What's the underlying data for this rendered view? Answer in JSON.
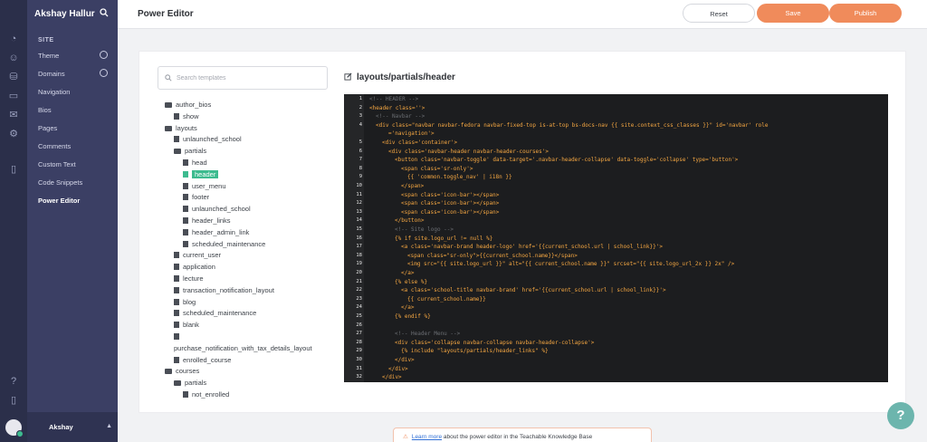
{
  "sidebar": {
    "user_name": "Akshay Hallur",
    "section": "SITE",
    "items": [
      {
        "label": "Theme",
        "status": true
      },
      {
        "label": "Domains",
        "status": true
      },
      {
        "label": "Navigation"
      },
      {
        "label": "Bios"
      },
      {
        "label": "Pages"
      },
      {
        "label": "Comments"
      },
      {
        "label": "Custom Text"
      },
      {
        "label": "Code Snippets"
      },
      {
        "label": "Power Editor",
        "active": true
      }
    ],
    "footer_name": "Akshay"
  },
  "header": {
    "title": "Power Editor",
    "reset_label": "Reset",
    "save_label": "Save",
    "publish_label": "Publish"
  },
  "search": {
    "placeholder": "Search templates"
  },
  "tree": [
    {
      "label": "author_bios",
      "kind": "folder",
      "depth": 0
    },
    {
      "label": "show",
      "kind": "file",
      "depth": 1
    },
    {
      "label": "layouts",
      "kind": "folder",
      "depth": 0
    },
    {
      "label": "unlaunched_school",
      "kind": "file",
      "depth": 1
    },
    {
      "label": "partials",
      "kind": "folder",
      "depth": 1
    },
    {
      "label": "head",
      "kind": "file",
      "depth": 2
    },
    {
      "label": "header",
      "kind": "file",
      "depth": 2,
      "selected": true
    },
    {
      "label": "user_menu",
      "kind": "file",
      "depth": 2
    },
    {
      "label": "footer",
      "kind": "file",
      "depth": 2
    },
    {
      "label": "unlaunched_school",
      "kind": "file",
      "depth": 2
    },
    {
      "label": "header_links",
      "kind": "file",
      "depth": 2
    },
    {
      "label": "header_admin_link",
      "kind": "file",
      "depth": 2
    },
    {
      "label": "scheduled_maintenance",
      "kind": "file",
      "depth": 2
    },
    {
      "label": "current_user",
      "kind": "file",
      "depth": 1
    },
    {
      "label": "application",
      "kind": "file",
      "depth": 1
    },
    {
      "label": "lecture",
      "kind": "file",
      "depth": 1
    },
    {
      "label": "transaction_notification_layout",
      "kind": "file",
      "depth": 1
    },
    {
      "label": "blog",
      "kind": "file",
      "depth": 1
    },
    {
      "label": "scheduled_maintenance",
      "kind": "file",
      "depth": 1
    },
    {
      "label": "blank",
      "kind": "file",
      "depth": 1
    },
    {
      "label": "",
      "kind": "file",
      "depth": 1
    },
    {
      "label": "purchase_notification_with_tax_details_layout",
      "kind": "text",
      "depth": 1
    },
    {
      "label": "enrolled_course",
      "kind": "file",
      "depth": 1
    },
    {
      "label": "courses",
      "kind": "folder",
      "depth": 0
    },
    {
      "label": "partials",
      "kind": "folder",
      "depth": 1
    },
    {
      "label": "not_enrolled",
      "kind": "file",
      "depth": 2
    }
  ],
  "editor": {
    "file_path": "layouts/partials/header",
    "lines": [
      {
        "n": 1,
        "text": "<!-- HEADER -->",
        "kind": "cm",
        "indent": 0
      },
      {
        "n": 2,
        "text": "<header class=''>",
        "kind": "tg",
        "indent": 0
      },
      {
        "n": 3,
        "text": "<!-- Navbar -->",
        "kind": "cm",
        "indent": 1
      },
      {
        "n": 4,
        "text": "<div class=\"navbar navbar-fedora navbar-fixed-top is-at-top bs-docs-nav {{ site.context_css_classes }}\" id='navbar' role",
        "kind": "tg",
        "indent": 1
      },
      {
        "n": null,
        "text": "='navigation'>",
        "kind": "tg",
        "indent": 3
      },
      {
        "n": 5,
        "text": "<div class='container'>",
        "kind": "tg",
        "indent": 2
      },
      {
        "n": 6,
        "text": "<div class='navbar-header navbar-header-courses'>",
        "kind": "tg",
        "indent": 3
      },
      {
        "n": 7,
        "text": "<button class='navbar-toggle' data-target='.navbar-header-collapse' data-toggle='collapse' type='button'>",
        "kind": "tg",
        "indent": 4
      },
      {
        "n": 8,
        "text": "<span class='sr-only'>",
        "kind": "tg",
        "indent": 5
      },
      {
        "n": 9,
        "text": "{{ 'common.toggle_nav' | i18n }}",
        "kind": "tg",
        "indent": 6
      },
      {
        "n": 10,
        "text": "</span>",
        "kind": "tg",
        "indent": 5
      },
      {
        "n": 11,
        "text": "<span class='icon-bar'></span>",
        "kind": "tg",
        "indent": 5
      },
      {
        "n": 12,
        "text": "<span class='icon-bar'></span>",
        "kind": "tg",
        "indent": 5
      },
      {
        "n": 13,
        "text": "<span class='icon-bar'></span>",
        "kind": "tg",
        "indent": 5
      },
      {
        "n": 14,
        "text": "</button>",
        "kind": "tg",
        "indent": 4
      },
      {
        "n": 15,
        "text": "<!-- Site logo -->",
        "kind": "cm",
        "indent": 4
      },
      {
        "n": 16,
        "text": "{% if site.logo_url != null %}",
        "kind": "tg",
        "indent": 4
      },
      {
        "n": 17,
        "text": "<a class='navbar-brand header-logo' href='{{current_school.url | school_link}}'>",
        "kind": "tg",
        "indent": 5
      },
      {
        "n": 18,
        "text": "<span class=\"sr-only\">{{current_school.name}}</span>",
        "kind": "tg",
        "indent": 6
      },
      {
        "n": 19,
        "text": "<img src=\"{{ site.logo_url }}\" alt=\"{{ current_school.name }}\" srcset=\"{{ site.logo_url_2x }} 2x\" />",
        "kind": "tg",
        "indent": 6
      },
      {
        "n": 20,
        "text": "</a>",
        "kind": "tg",
        "indent": 5
      },
      {
        "n": 21,
        "text": "{% else %}",
        "kind": "tg",
        "indent": 4
      },
      {
        "n": 22,
        "text": "<a class='school-title navbar-brand' href='{{current_school.url | school_link}}'>",
        "kind": "tg",
        "indent": 5
      },
      {
        "n": 23,
        "text": "{{ current_school.name}}",
        "kind": "tg",
        "indent": 6
      },
      {
        "n": 24,
        "text": "</a>",
        "kind": "tg",
        "indent": 5
      },
      {
        "n": 25,
        "text": "{% endif %}",
        "kind": "tg",
        "indent": 4
      },
      {
        "n": 26,
        "text": "",
        "kind": "tg",
        "indent": 0
      },
      {
        "n": 27,
        "text": "<!-- Header Menu -->",
        "kind": "cm",
        "indent": 4
      },
      {
        "n": 28,
        "text": "<div class='collapse navbar-collapse navbar-header-collapse'>",
        "kind": "tg",
        "indent": 4
      },
      {
        "n": 29,
        "text": "{% include \"layouts/partials/header_links\" %}",
        "kind": "tg",
        "indent": 5
      },
      {
        "n": 30,
        "text": "</div>",
        "kind": "tg",
        "indent": 4
      },
      {
        "n": 31,
        "text": "</div>",
        "kind": "tg",
        "indent": 3
      },
      {
        "n": 32,
        "text": "</div>",
        "kind": "tg",
        "indent": 2
      }
    ]
  },
  "kb_notice": {
    "link_text": "Learn more",
    "rest_text": " about the power editor in the Teachable Knowledge Base"
  },
  "help_label": "?",
  "colors": {
    "accent": "#f08b5b",
    "selected": "#3dbb8f",
    "sidebar": "#3b3f64",
    "rail": "#2b2f4a"
  }
}
